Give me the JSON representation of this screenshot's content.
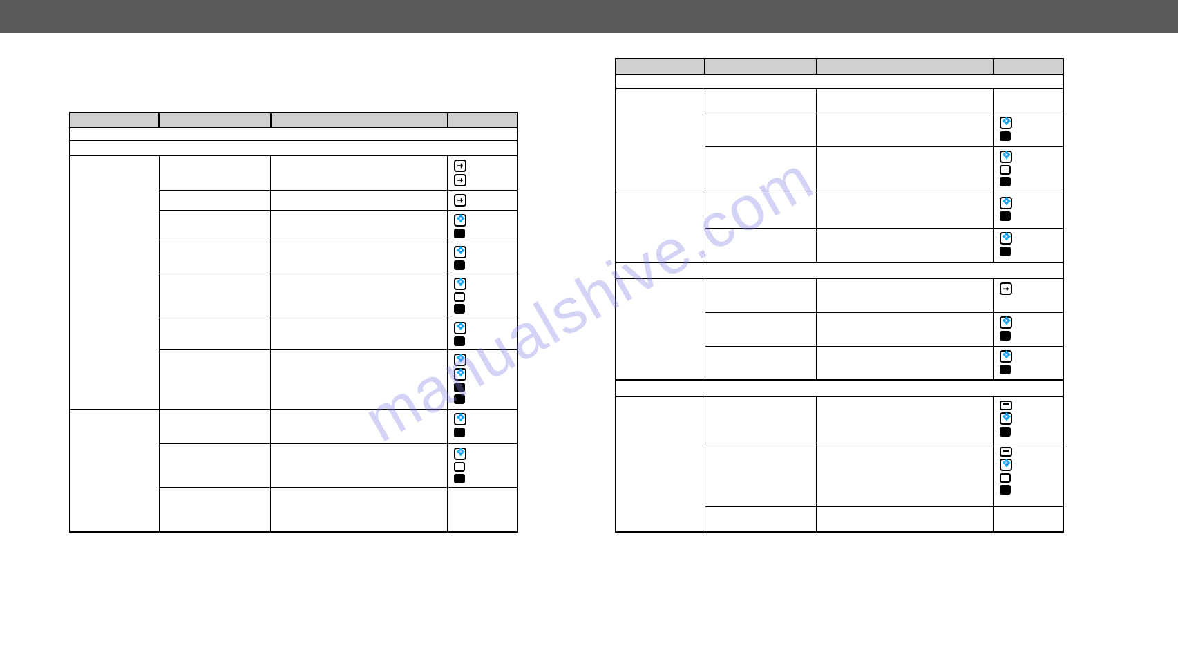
{
  "watermark": "manualshive.com",
  "table_left": {
    "header_cols": [
      "",
      "",
      "",
      ""
    ],
    "sub_header": [
      ""
    ],
    "section1": "",
    "rows": [
      {
        "group": "",
        "label": "",
        "text": "",
        "icons": [
          "spray",
          "spray"
        ]
      },
      {
        "group": "",
        "label": "",
        "text": "",
        "icons": [
          "spray"
        ]
      },
      {
        "group": "",
        "label": "",
        "text": "",
        "icons": [
          "water",
          "full"
        ]
      },
      {
        "group": "",
        "label": "",
        "text": "",
        "icons": [
          "water",
          "full"
        ]
      },
      {
        "group": "",
        "label": "",
        "text": "",
        "icons": [
          "water",
          "empty",
          "full"
        ]
      },
      {
        "group": "",
        "label": "",
        "text": "",
        "icons": [
          "water",
          "full"
        ]
      },
      {
        "group": "",
        "label": "",
        "text": "",
        "icons": [
          "water",
          "water",
          "full",
          "full"
        ]
      },
      {
        "group": "",
        "label": "",
        "text": "",
        "icons": [
          "water",
          "full"
        ]
      },
      {
        "group": "",
        "label": "",
        "text": "",
        "icons": [
          "water",
          "empty",
          "full"
        ]
      },
      {
        "group": "",
        "label": "",
        "text": "",
        "icons": []
      }
    ]
  },
  "table_right": {
    "header_cols": [
      "",
      "",
      "",
      ""
    ],
    "sub_header": [
      ""
    ],
    "rows_block1": [
      {
        "group": "",
        "label": "",
        "text": "",
        "icons": []
      },
      {
        "group": "",
        "label": "",
        "text": "",
        "icons": [
          "water",
          "full"
        ]
      },
      {
        "group": "",
        "label": "",
        "text": "",
        "icons": [
          "water",
          "empty",
          "full"
        ]
      },
      {
        "group": "",
        "label": "",
        "text": "",
        "icons": [
          "water",
          "full"
        ]
      },
      {
        "group": "",
        "label": "",
        "text": "",
        "icons": [
          "water",
          "full"
        ]
      }
    ],
    "section2": "",
    "rows_block2": [
      {
        "group": "",
        "label": "",
        "text": "",
        "icons": [
          "spray"
        ]
      },
      {
        "group": "",
        "label": "",
        "text": "",
        "icons": [
          "water",
          "full"
        ]
      },
      {
        "group": "",
        "label": "",
        "text": "",
        "icons": [
          "water",
          "full"
        ]
      }
    ],
    "section3": "",
    "rows_block3": [
      {
        "group": "",
        "label": "",
        "text": "",
        "icons": [
          "card",
          "water",
          "full"
        ]
      },
      {
        "group": "",
        "label": "",
        "text": "",
        "icons": [
          "card",
          "water",
          "empty",
          "full"
        ]
      },
      {
        "group": "",
        "label": "",
        "text": "",
        "icons": []
      }
    ]
  }
}
